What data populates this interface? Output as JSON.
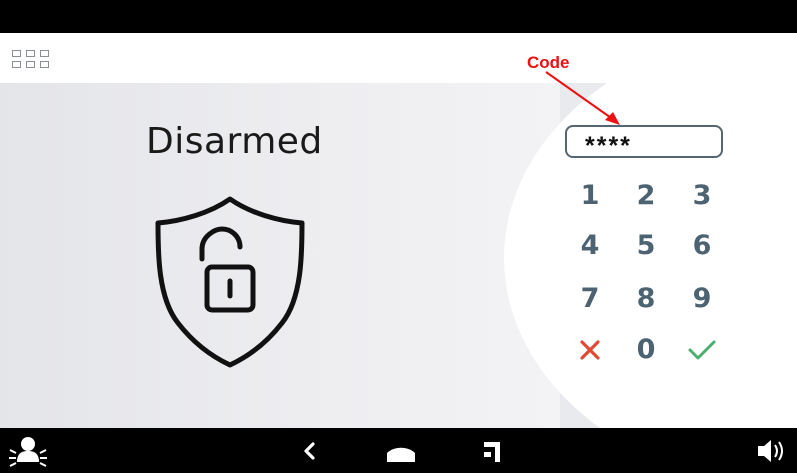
{
  "status": {
    "title": "Disarmed"
  },
  "annotation": {
    "label": "Code"
  },
  "code_field": {
    "value": "****"
  },
  "keypad": {
    "keys": [
      "1",
      "2",
      "3",
      "4",
      "5",
      "6",
      "7",
      "8",
      "9",
      "0"
    ],
    "cancel_icon": "cross-icon",
    "confirm_icon": "check-icon",
    "cancel_color": "#e04a33",
    "confirm_color": "#4caf72"
  },
  "nav_bar": {
    "icons": [
      "panic-icon",
      "back-icon",
      "home-icon",
      "recent-apps-icon",
      "volume-icon"
    ]
  },
  "app_bar": {
    "icon": "apps-grid-icon"
  },
  "colors": {
    "key_text": "#4d6371",
    "annotation": "#ee1111",
    "bars": "#000000"
  }
}
